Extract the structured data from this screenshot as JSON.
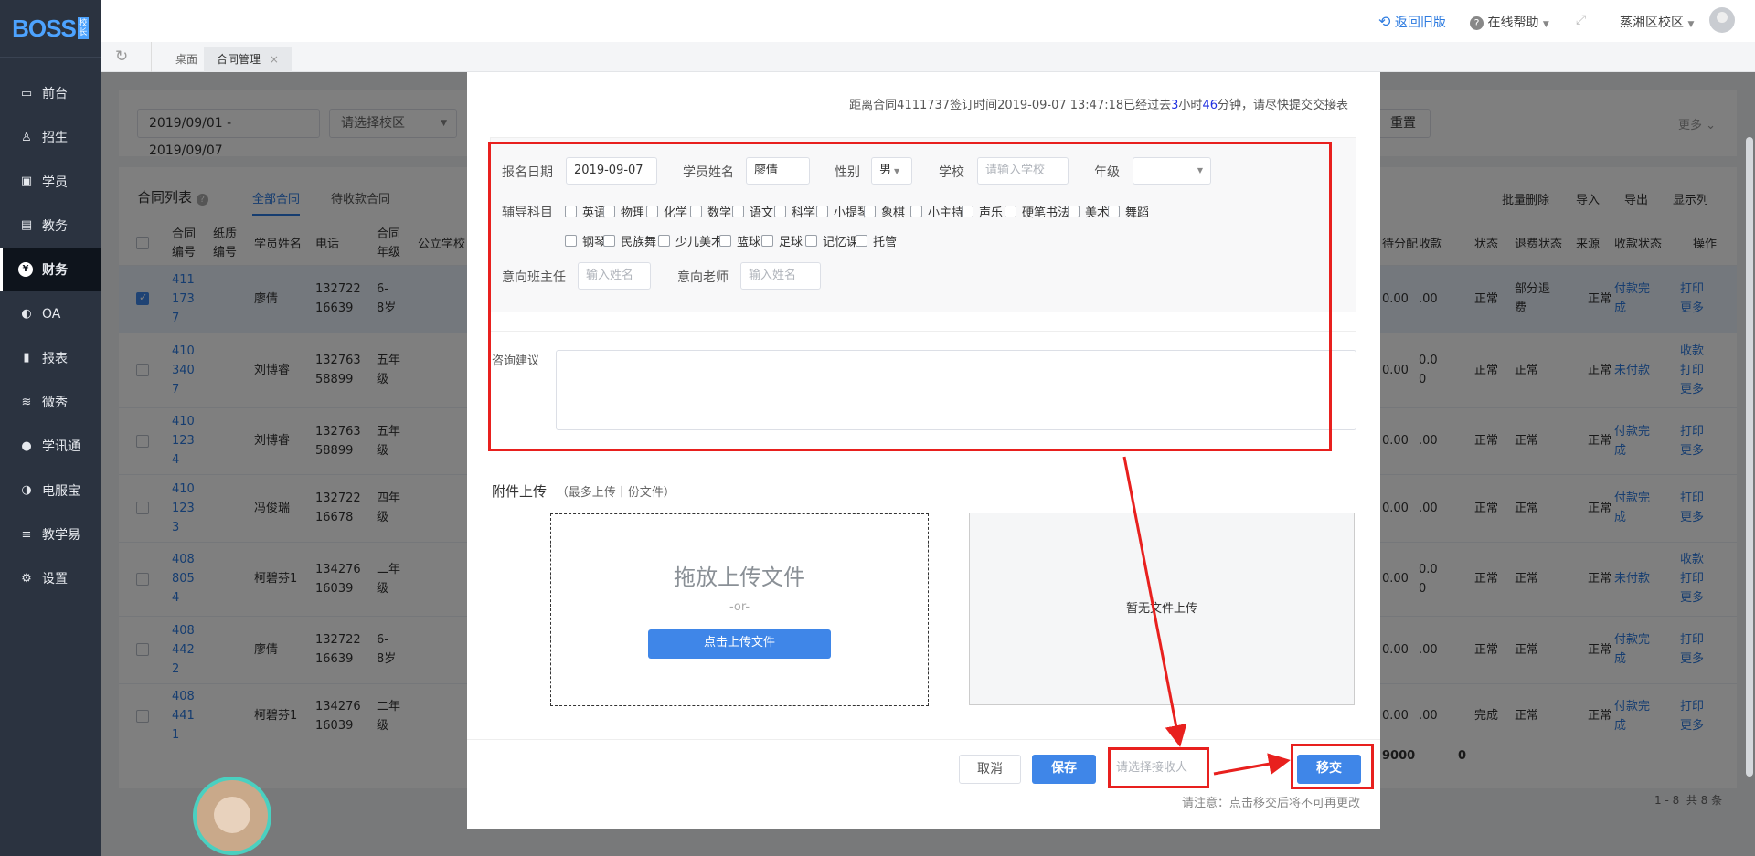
{
  "sidebar": {
    "logo": "BOSS",
    "logo_badge": "校长",
    "items": [
      {
        "label": "前台",
        "icon": "calendar-icon"
      },
      {
        "label": "招生",
        "icon": "user-add-icon"
      },
      {
        "label": "学员",
        "icon": "id-card-icon"
      },
      {
        "label": "教务",
        "icon": "book-icon"
      },
      {
        "label": "财务",
        "icon": "yen-icon",
        "active": true
      },
      {
        "label": "OA",
        "icon": "toggle-icon"
      },
      {
        "label": "报表",
        "icon": "bar-chart-icon"
      },
      {
        "label": "微秀",
        "icon": "wave-icon"
      },
      {
        "label": "学讯通",
        "icon": "location-icon"
      },
      {
        "label": "电服宝",
        "icon": "phone-icon"
      },
      {
        "label": "教学易",
        "icon": "teach-icon"
      },
      {
        "label": "设置",
        "icon": "gear-icon"
      }
    ]
  },
  "topbar": {
    "back": "返回旧版",
    "help": "在线帮助",
    "campus": "蒸湘区校区"
  },
  "tabs": {
    "desk": "桌面",
    "contract": "合同管理"
  },
  "filters": {
    "date_range": "2019/09/01 - 2019/09/07",
    "campus_placeholder": "请选择校区",
    "reset": "重置",
    "more": "更多"
  },
  "list": {
    "title": "合同列表",
    "tab_all": "全部合同",
    "tab_pending": "待收款合同",
    "actions": {
      "batch_delete": "批量删除",
      "import": "导入",
      "export": "导出",
      "columns": "显示列"
    },
    "headers": {
      "contract_no": "合同编号",
      "paper_no": "纸质编号",
      "student": "学员姓名",
      "phone": "电话",
      "grade": "合同年级",
      "school": "公立学校",
      "amount": "收款",
      "pending": "待分配",
      "status": "状态",
      "refund": "退费状态",
      "source": "来源",
      "pay_status": "收款状态",
      "op": "操作"
    },
    "rows": [
      {
        "no": "4111737",
        "name": "廖倩",
        "phone": "13272216639",
        "grade": "6-8岁",
        "amount": ".00",
        "pending": "0.00",
        "status": "正常",
        "refund": "部分退费",
        "source": "正常",
        "pay": "付款完成",
        "ops": [
          "打印",
          "更多"
        ],
        "checked": true
      },
      {
        "no": "4103407",
        "name": "刘博睿",
        "phone": "13276358899",
        "grade": "五年级",
        "amount": "0.00",
        "pending": "0.00",
        "status": "正常",
        "refund": "正常",
        "source": "正常",
        "pay": "未付款",
        "ops": [
          "收款",
          "打印",
          "更多"
        ]
      },
      {
        "no": "4101234",
        "name": "刘博睿",
        "phone": "13276358899",
        "grade": "五年级",
        "amount": ".00",
        "pending": "0.00",
        "status": "正常",
        "refund": "正常",
        "source": "正常",
        "pay": "付款完成",
        "ops": [
          "打印",
          "更多"
        ]
      },
      {
        "no": "4101233",
        "name": "冯俊瑞",
        "phone": "13272216678",
        "grade": "四年级",
        "amount": ".00",
        "pending": "0.00",
        "status": "正常",
        "refund": "正常",
        "source": "正常",
        "pay": "付款完成",
        "ops": [
          "打印",
          "更多"
        ]
      },
      {
        "no": "4088054",
        "name": "柯碧芬1",
        "phone": "13427616039",
        "grade": "二年级",
        "amount": "0.00",
        "pending": "0.00",
        "status": "正常",
        "refund": "正常",
        "source": "正常",
        "pay": "未付款",
        "ops": [
          "收款",
          "打印",
          "更多"
        ]
      },
      {
        "no": "4084422",
        "name": "廖倩",
        "phone": "13272216639",
        "grade": "6-8岁",
        "amount": ".00",
        "pending": "0.00",
        "status": "正常",
        "refund": "正常",
        "source": "正常",
        "pay": "付款完成",
        "ops": [
          "打印",
          "更多"
        ]
      },
      {
        "no": "4084411",
        "name": "柯碧芬1",
        "phone": "13427616039",
        "grade": "二年级",
        "amount": ".00",
        "pending": "0.00",
        "status": "完成",
        "refund": "正常",
        "source": "正常",
        "pay": "付款完成",
        "ops": [
          "打印",
          "更多"
        ]
      }
    ],
    "total_amount": "9000",
    "total_pending": "0",
    "pagination": "1 - 8  共 8 条"
  },
  "modal": {
    "notice_prefix": "距离合同4111737签订时间2019-09-07 13:47:18已经过去",
    "notice_hours": "3",
    "notice_h_unit": "小时",
    "notice_minutes": "46",
    "notice_suffix": "分钟，请尽快提交交接表",
    "form": {
      "signup_date_label": "报名日期",
      "signup_date": "2019-09-07",
      "student_label": "学员姓名",
      "student": "廖倩",
      "gender_label": "性别",
      "gender": "男",
      "school_label": "学校",
      "school_placeholder": "请输入学校",
      "grade_label": "年级",
      "subject_label": "辅导科目",
      "subjects_row1": [
        "英语",
        "物理",
        "化学",
        "数学",
        "语文",
        "科学",
        "小提琴",
        "象棋",
        "小主持",
        "声乐",
        "硬笔书法",
        "美术",
        "舞蹈"
      ],
      "subjects_row2": [
        "钢琴",
        "民族舞",
        "少儿美术",
        "篮球",
        "足球",
        "记忆课",
        "托管"
      ],
      "head_teacher_label": "意向班主任",
      "head_teacher_placeholder": "输入姓名",
      "teacher_label": "意向老师",
      "teacher_placeholder": "输入姓名",
      "advice_label": "咨询建议"
    },
    "upload": {
      "title": "附件上传",
      "hint": "（最多上传十份文件）",
      "drop_text": "拖放上传文件",
      "or": "-or-",
      "button": "点击上传文件",
      "empty": "暂无文件上传"
    },
    "footer": {
      "cancel": "取消",
      "save": "保存",
      "receiver_placeholder": "请选择接收人",
      "transfer": "移交",
      "note": "请注意：点击移交后将不可再更改"
    }
  },
  "colors": {
    "primary": "#3f86e8",
    "annotation": "#e8201e",
    "sidebar": "#2b3340"
  }
}
